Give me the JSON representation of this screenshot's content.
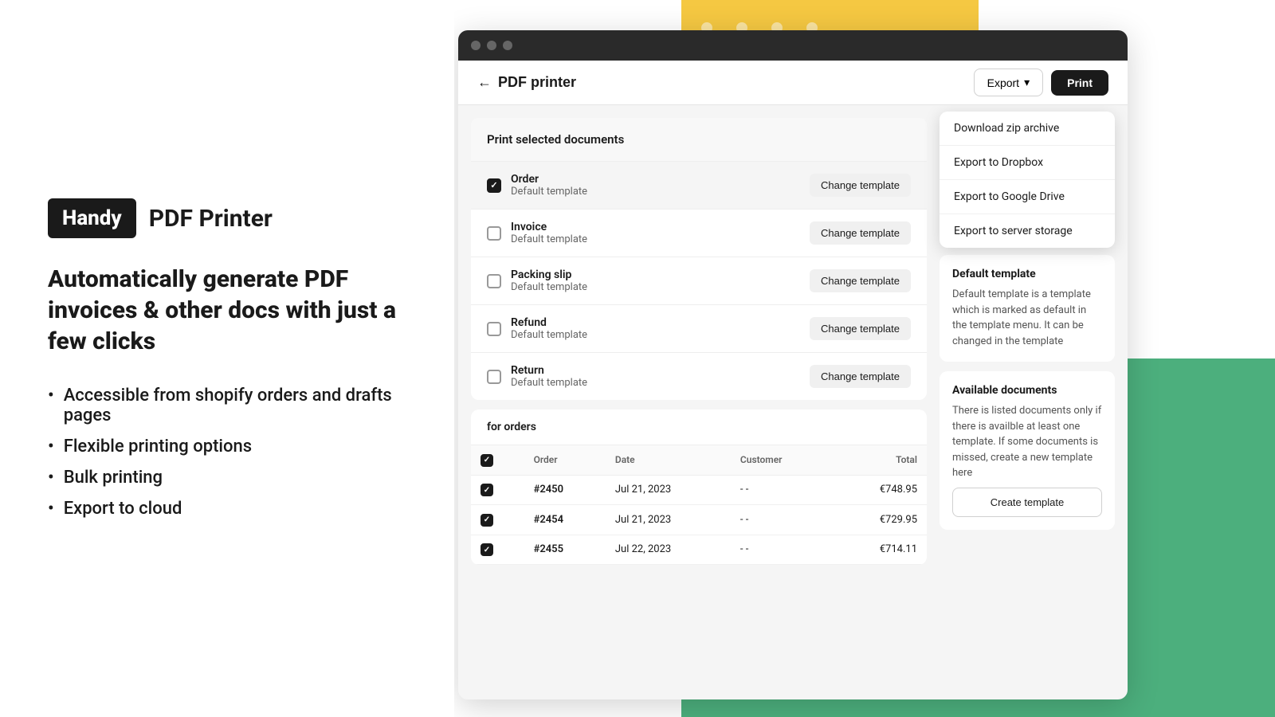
{
  "logo": {
    "brand": "Handy",
    "product": "PDF Printer"
  },
  "tagline": "Automatically generate PDF invoices & other docs with just a few clicks",
  "features": [
    "Accessible from shopify orders and drafts pages",
    "Flexible printing options",
    "Bulk printing",
    "Export to cloud"
  ],
  "app": {
    "title": "PDF printer",
    "buttons": {
      "export": "Export",
      "print": "Print"
    },
    "documents_section": {
      "header": "Print selected documents",
      "rows": [
        {
          "name": "Order",
          "template": "Default template",
          "checked": true
        },
        {
          "name": "Invoice",
          "template": "Default template",
          "checked": false
        },
        {
          "name": "Packing slip",
          "template": "Default template",
          "checked": false
        },
        {
          "name": "Refund",
          "template": "Default template",
          "checked": false
        },
        {
          "name": "Return",
          "template": "Default template",
          "checked": false
        }
      ],
      "change_template_label": "Change template"
    },
    "orders_section": {
      "header": "for orders",
      "columns": [
        "Order",
        "Date",
        "Customer",
        "Total"
      ],
      "rows": [
        {
          "id": "#2450",
          "date": "Jul 21, 2023",
          "customer": "- -",
          "total": "€748.95"
        },
        {
          "id": "#2454",
          "date": "Jul 21, 2023",
          "customer": "- -",
          "total": "€729.95"
        },
        {
          "id": "#2455",
          "date": "Jul 22, 2023",
          "customer": "- -",
          "total": "€714.11"
        }
      ]
    },
    "default_template_card": {
      "title": "Default template",
      "description": "Default template is a template which is marked as default in the template menu. It can be changed in the template"
    },
    "available_docs_card": {
      "title": "Available documents",
      "description": "There is listed documents only if there is availble at least one template. If some documents is missed, create a new template here",
      "create_button": "Create template"
    },
    "dropdown": {
      "items": [
        "Download zip archive",
        "Export to Dropbox",
        "Export to Google Drive",
        "Export to server storage"
      ]
    }
  }
}
